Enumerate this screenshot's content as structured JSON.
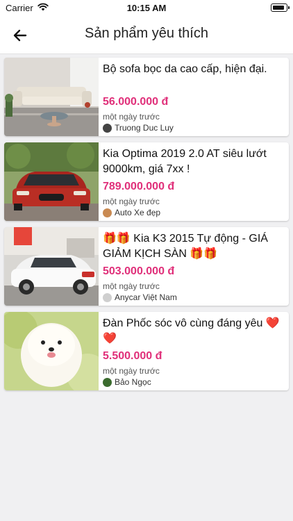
{
  "status": {
    "carrier": "Carrier",
    "time": "10:15 AM"
  },
  "header": {
    "title": "Sản phẩm yêu thích"
  },
  "products": [
    {
      "title": "Bộ sofa bọc da cao cấp, hiện đại.",
      "price": "56.000.000 đ",
      "time": "một ngày trước",
      "seller": "Truong Duc Luy"
    },
    {
      "title": "Kia Optima 2019 2.0 AT siêu lướt 9000km, giá 7xx !",
      "price": "789.000.000 đ",
      "time": "một ngày trước",
      "seller": "Auto Xe đẹp"
    },
    {
      "title": "🎁🎁 Kia K3 2015 Tự động - GIÁ GIẢM KỊCH SÀN 🎁🎁",
      "price": "503.000.000 đ",
      "time": "một ngày trước",
      "seller": "Anycar Việt Nam"
    },
    {
      "title": "Đàn Phốc sóc vô cùng đáng yêu ❤️❤️",
      "price": "5.500.000 đ",
      "time": "một ngày trước",
      "seller": "Bảo Ngọc"
    }
  ],
  "icons": {
    "back": "arrow-left-icon",
    "wifi": "wifi-icon",
    "battery": "battery-icon"
  },
  "colors": {
    "price": "#e0307a",
    "background": "#f0f0f2"
  }
}
